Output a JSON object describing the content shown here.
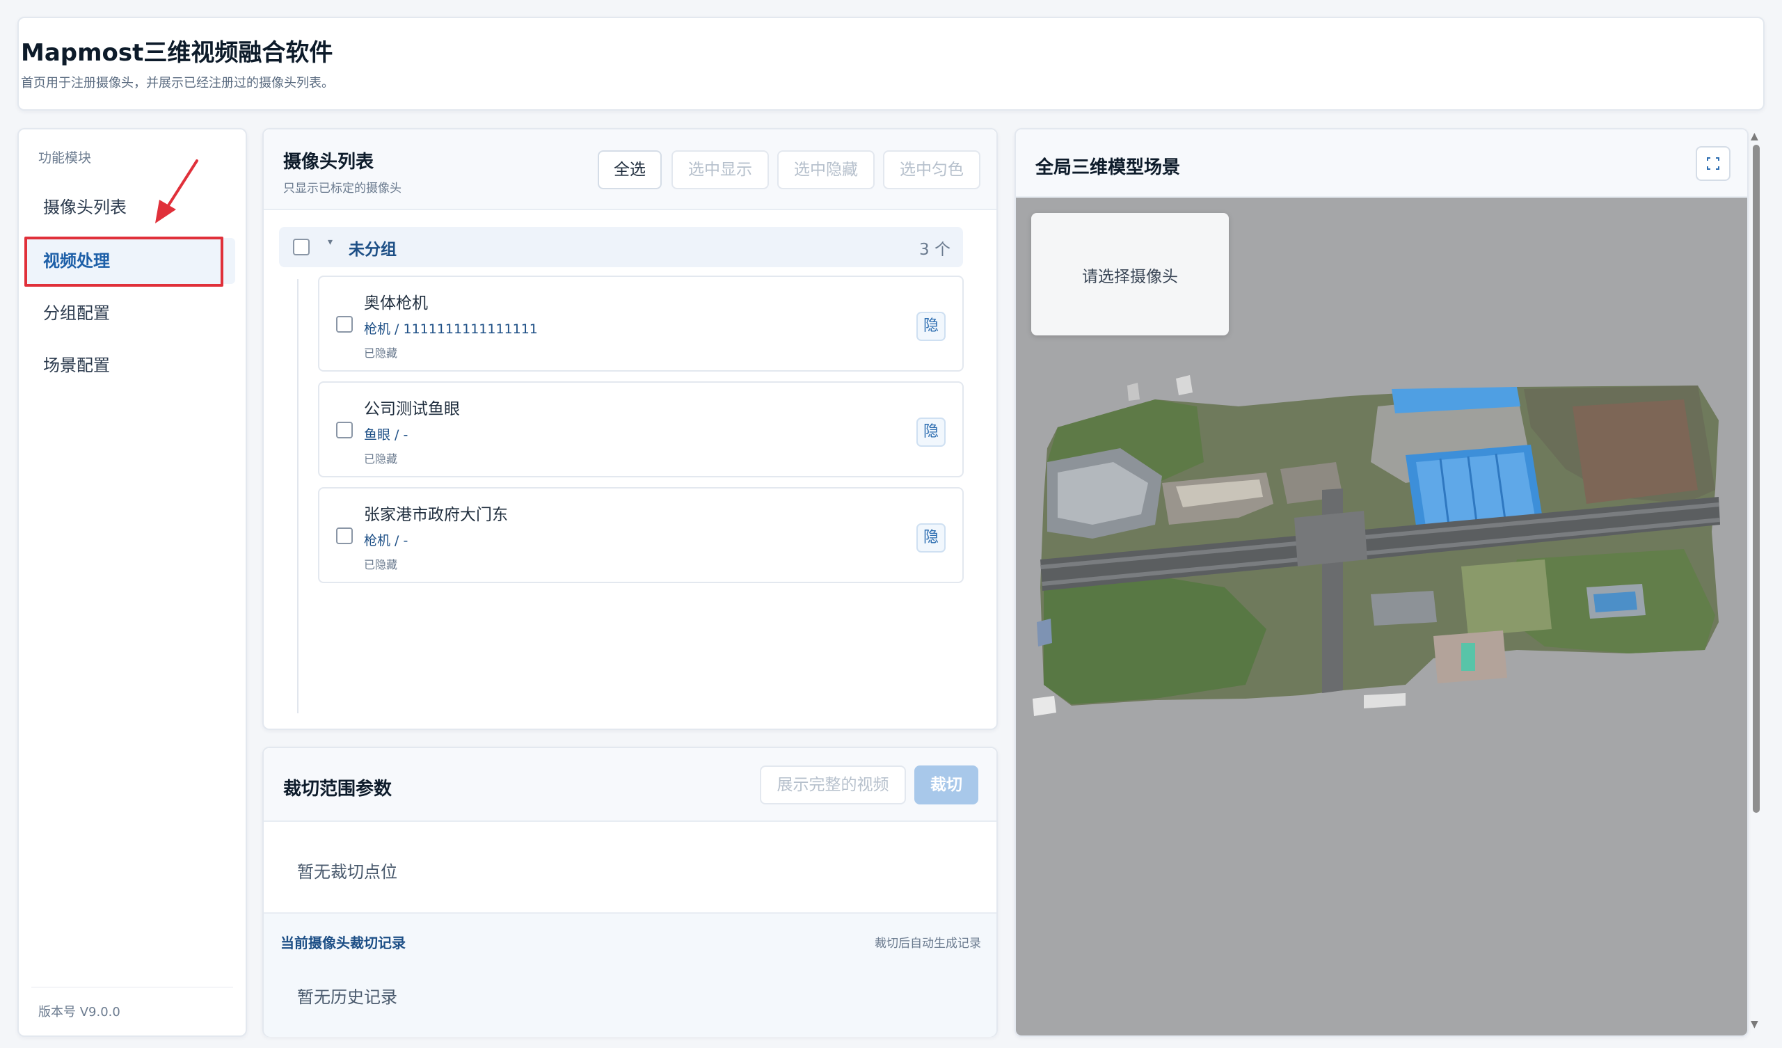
{
  "header": {
    "title": "Mapmost三维视频融合软件",
    "subtitle": "首页用于注册摄像头，并展示已经注册过的摄像头列表。"
  },
  "sidebar": {
    "section_label": "功能模块",
    "items": [
      {
        "label": "摄像头列表"
      },
      {
        "label": "视频处理",
        "active": true
      },
      {
        "label": "分组配置"
      },
      {
        "label": "场景配置"
      }
    ],
    "version": "版本号 V9.0.0"
  },
  "camera_panel": {
    "title": "摄像头列表",
    "subtitle": "只显示已标定的摄像头",
    "buttons": {
      "select_all": "全选",
      "show_selected": "选中显示",
      "hide_selected": "选中隐藏",
      "color_selected": "选中匀色"
    },
    "group": {
      "name": "未分组",
      "count": "3 个"
    },
    "cameras": [
      {
        "name": "奥体枪机",
        "meta": "枪机 / 1111111111111111",
        "state": "已隐藏",
        "hide_label": "隐"
      },
      {
        "name": "公司测试鱼眼",
        "meta": "鱼眼 / -",
        "state": "已隐藏",
        "hide_label": "隐"
      },
      {
        "name": "张家港市政府大门东",
        "meta": "枪机 / -",
        "state": "已隐藏",
        "hide_label": "隐"
      }
    ]
  },
  "crop_panel": {
    "title": "裁切范围参数",
    "show_full_label": "展示完整的视频",
    "crop_label": "裁切",
    "empty_text": "暂无裁切点位",
    "history_title": "当前摄像头裁切记录",
    "history_hint": "裁切后自动生成记录",
    "history_empty": "暂无历史记录"
  },
  "scene_panel": {
    "title": "全局三维模型场景",
    "popup_text": "请选择摄像头",
    "fullscreen_icon": "fullscreen-icon"
  },
  "colors": {
    "accent": "#1d5fa8",
    "highlight_border": "#e0303a",
    "primary_button": "#a8c8ea"
  }
}
